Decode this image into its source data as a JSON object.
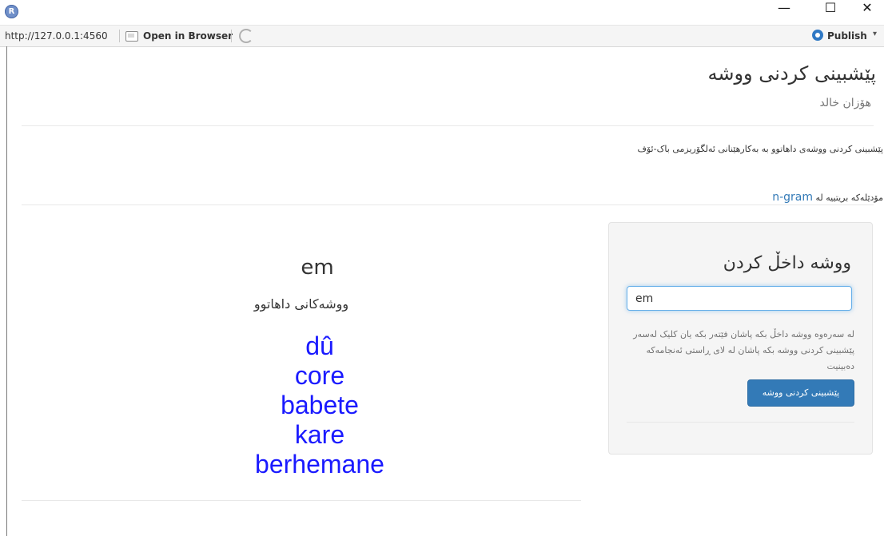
{
  "window": {
    "logo": "R",
    "controls": {
      "minimize": "—",
      "maximize": "☐",
      "close": "✕"
    }
  },
  "toolbar": {
    "url": "http://127.0.0.1:4560",
    "open_in_browser": "Open in Browser",
    "publish": "Publish",
    "publish_caret": "▾"
  },
  "header": {
    "title": "پێشبینی کردنی ووشه",
    "subtitle": "هۆزان خالد"
  },
  "description": {
    "line1": "پێشبینی کردنی ووشەی داهاتوو بە بەکارهێنانی ئەلگۆریزمی باک-ئۆف",
    "line2_prefix": "مۆدێلەکە بریتییە لە",
    "line2_link": "n-gram"
  },
  "sidebar_panel": {
    "title": "ووشه داخڵ کردن",
    "input_value": "em",
    "help_text": "له سەرەوە ووشە داخڵ بکە پاشان فێتەر بکە یان کلیک لەسەر پێشبینی کردنی ووشە بکە پاشان لە لای ڕاستی ئەنجامەکە دەبینیت",
    "button_label": "پێشبینی کردنی ووشه"
  },
  "main": {
    "entered_word": "em",
    "predictions_heading": "ووشەکانی داهاتوو",
    "predictions": [
      "dû",
      "core",
      "babete",
      "kare",
      "berhemane"
    ]
  }
}
